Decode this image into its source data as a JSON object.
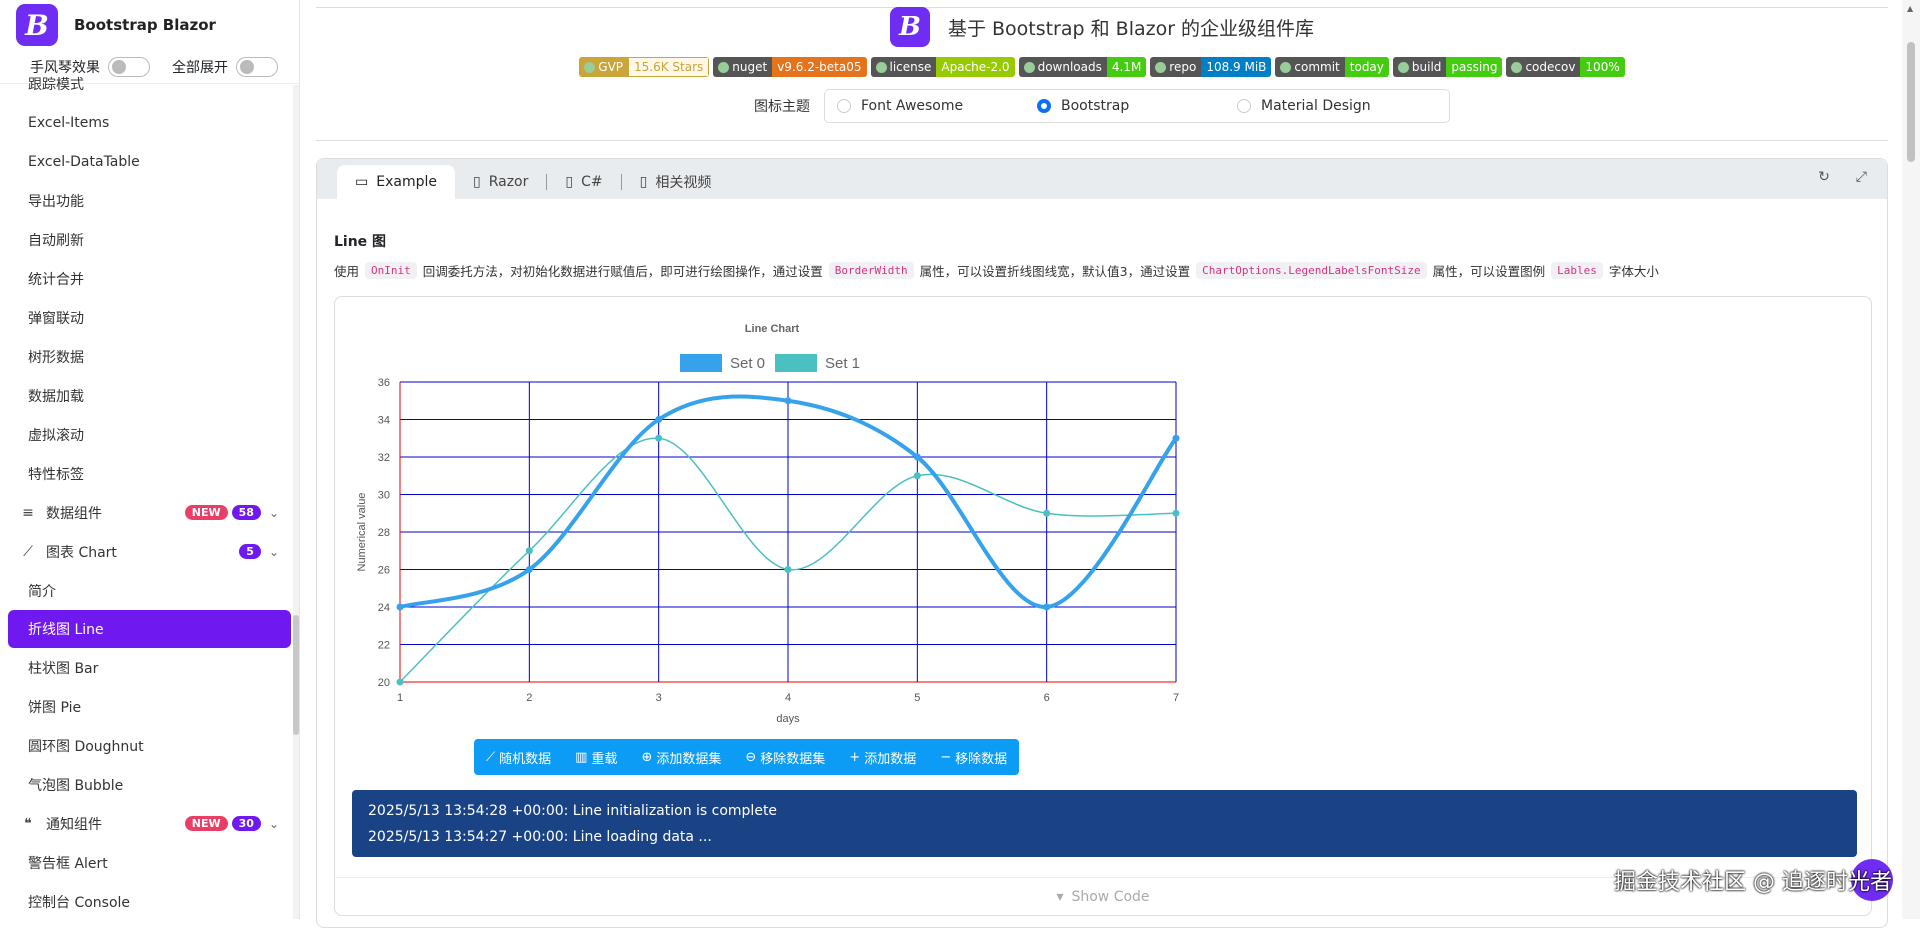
{
  "brand": {
    "logo": "B",
    "name": "Bootstrap Blazor"
  },
  "toggles": {
    "accordion": "手风琴效果",
    "expand_all": "全部展开"
  },
  "sidebar": {
    "items": [
      {
        "label": "跟踪模式",
        "type": "item"
      },
      {
        "label": "Excel-Items",
        "type": "item"
      },
      {
        "label": "Excel-DataTable",
        "type": "item"
      },
      {
        "label": "导出功能",
        "type": "item"
      },
      {
        "label": "自动刷新",
        "type": "item"
      },
      {
        "label": "统计合并",
        "type": "item"
      },
      {
        "label": "弹窗联动",
        "type": "item"
      },
      {
        "label": "树形数据",
        "type": "item"
      },
      {
        "label": "数据加载",
        "type": "item"
      },
      {
        "label": "虚拟滚动",
        "type": "item"
      },
      {
        "label": "特性标签",
        "type": "item"
      },
      {
        "label": "数据组件",
        "type": "group",
        "icon": "database-icon",
        "badge_new": "NEW",
        "count": "58"
      },
      {
        "label": "图表 Chart",
        "type": "group",
        "icon": "chart-line-icon",
        "count": "5"
      },
      {
        "label": "简介",
        "type": "item"
      },
      {
        "label": "折线图 Line",
        "type": "active"
      },
      {
        "label": "柱状图 Bar",
        "type": "item"
      },
      {
        "label": "饼图 Pie",
        "type": "item"
      },
      {
        "label": "圆环图 Doughnut",
        "type": "item"
      },
      {
        "label": "气泡图 Bubble",
        "type": "item"
      },
      {
        "label": "通知组件",
        "type": "group",
        "icon": "comments-icon",
        "badge_new": "NEW",
        "count": "30"
      },
      {
        "label": "警告框 Alert",
        "type": "item"
      },
      {
        "label": "控制台 Console",
        "type": "item"
      }
    ]
  },
  "header": {
    "logo": "B",
    "title": "基于 Bootstrap 和 Blazor 的企业级组件库",
    "shields": [
      {
        "l": "GVP",
        "r": "15.6K Stars",
        "lc": "#c9a53a",
        "rc": "#fff8e6",
        "rt": "#c9a53a"
      },
      {
        "l": "nuget",
        "r": "v9.6.2-beta05",
        "lc": "#555",
        "rc": "#e4731c",
        "rt": "#fff"
      },
      {
        "l": "license",
        "r": "Apache-2.0",
        "lc": "#555",
        "rc": "#97ca00",
        "rt": "#fff"
      },
      {
        "l": "downloads",
        "r": "4.1M",
        "lc": "#555",
        "rc": "#4c1",
        "rt": "#fff"
      },
      {
        "l": "repo",
        "r": "108.9 MiB",
        "lc": "#555",
        "rc": "#007ec6",
        "rt": "#fff"
      },
      {
        "l": "commit",
        "r": "today",
        "lc": "#555",
        "rc": "#4c1",
        "rt": "#fff"
      },
      {
        "l": "build",
        "r": "passing",
        "lc": "#555",
        "rc": "#4c1",
        "rt": "#fff"
      },
      {
        "l": "codecov",
        "r": "100%",
        "lc": "#555",
        "rc": "#4c1",
        "rt": "#fff"
      }
    ],
    "theme_label": "图标主题",
    "theme_options": [
      "Font Awesome",
      "Bootstrap",
      "Material Design"
    ],
    "theme_selected": "Bootstrap"
  },
  "card": {
    "tabs": [
      "Example",
      "Razor",
      "C#",
      "相关视频"
    ],
    "title": "Line 图",
    "desc_parts": [
      "使用",
      "OnInit",
      "回调委托方法，对初始化数据进行赋值后，即可进行绘图操作，通过设置",
      "BorderWidth",
      "属性，可以设置折线图线宽，默认值3，通过设置",
      "ChartOptions.LegendLabelsFontSize",
      "属性，可以设置图例",
      "Lables",
      "字体大小"
    ],
    "buttons": [
      "随机数据",
      "重载",
      "添加数据集",
      "移除数据集",
      "添加数据",
      "移除数据"
    ],
    "logs": [
      "2025/5/13 13:54:28 +00:00: Line initialization is complete",
      "2025/5/13 13:54:27 +00:00: Line loading data ..."
    ],
    "show_code": "Show Code"
  },
  "watermark": "掘金技术社区 @ 追逐时光者",
  "chart_data": {
    "type": "line",
    "title": "Line Chart",
    "xlabel": "days",
    "ylabel": "Numerical value",
    "x": [
      1,
      2,
      3,
      4,
      5,
      6,
      7
    ],
    "ylim": [
      20,
      36
    ],
    "yticks": [
      20,
      22,
      24,
      26,
      28,
      30,
      32,
      34,
      36
    ],
    "grid": true,
    "legend_position": "top",
    "series": [
      {
        "name": "Set 0",
        "values": [
          24,
          26,
          34,
          35,
          32,
          24,
          33
        ],
        "color": "#36a2eb"
      },
      {
        "name": "Set 1",
        "values": [
          20,
          27,
          33,
          26,
          31,
          29,
          29
        ],
        "color": "#4bc0c0"
      }
    ]
  }
}
